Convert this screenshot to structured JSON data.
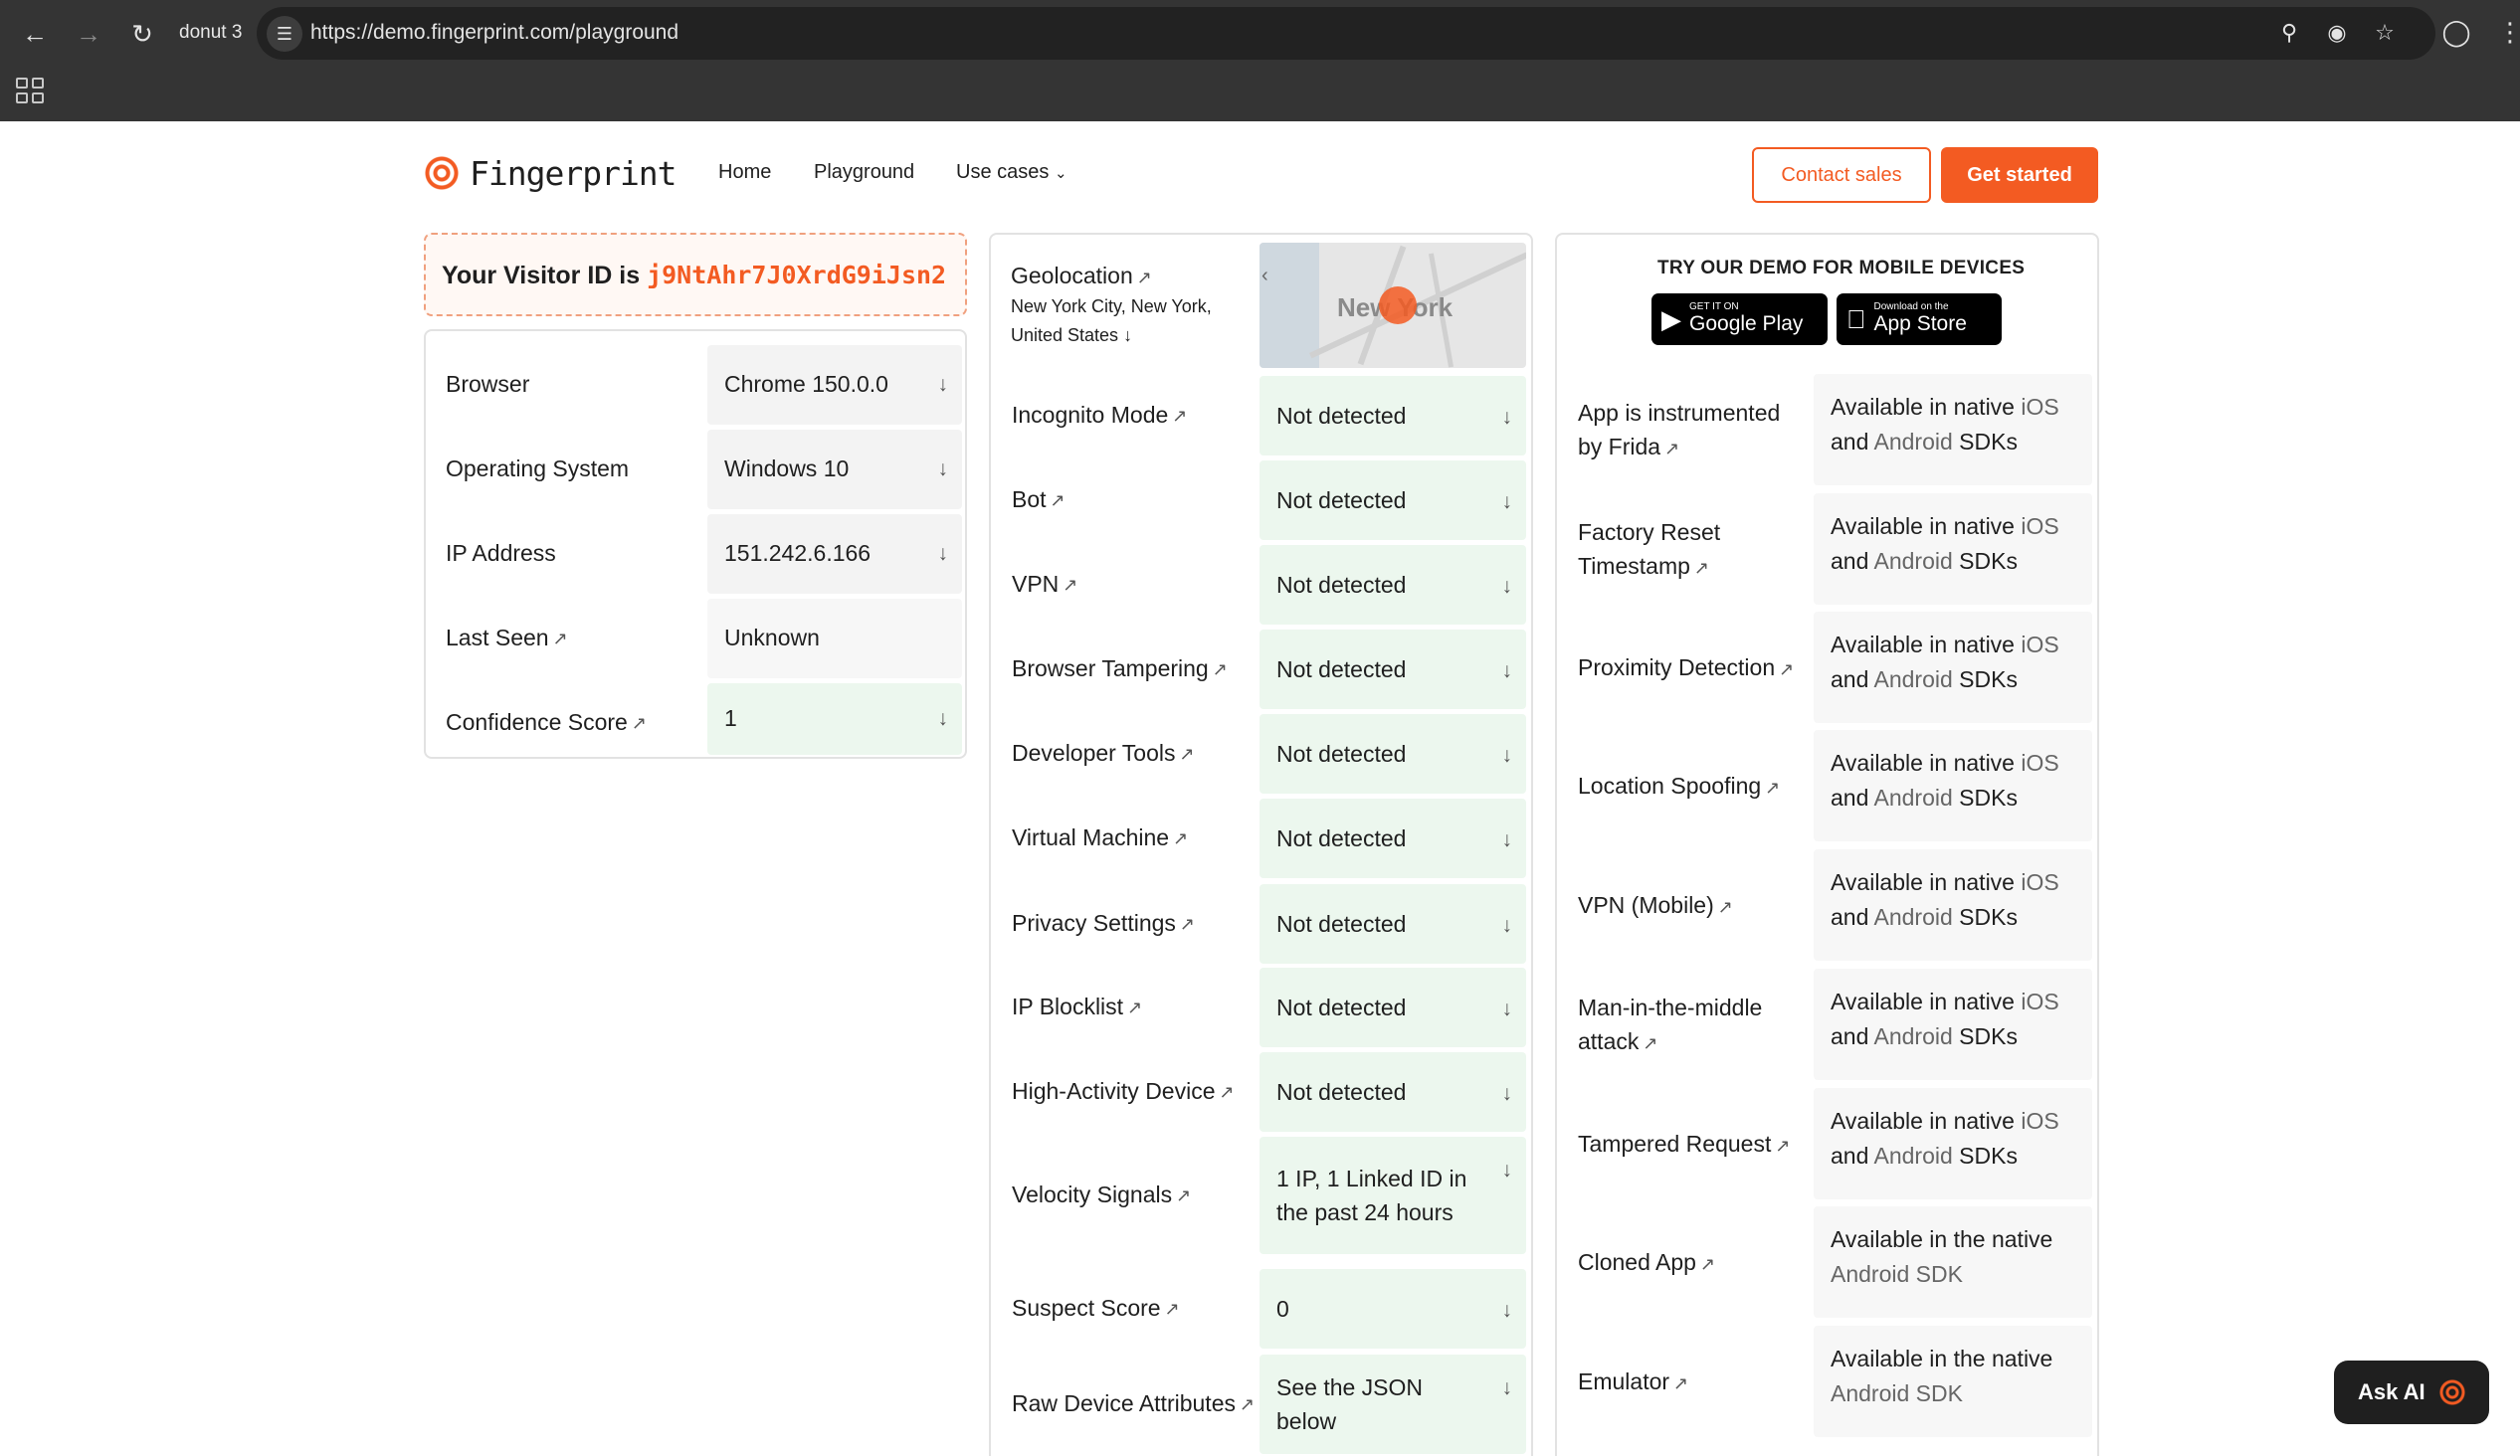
{
  "browser": {
    "tab_title": "donut 3",
    "url": "https://demo.fingerprint.com/playground"
  },
  "header": {
    "brand": "Fingerprint",
    "nav": [
      "Home",
      "Playground",
      "Use cases"
    ],
    "contact_sales": "Contact sales",
    "get_started": "Get started"
  },
  "visitor": {
    "prefix": "Your Visitor ID is",
    "id": "j9NtAhr7J0XrdG9iJsn2"
  },
  "identification": [
    {
      "label": "Browser",
      "value": "Chrome 150.0.0"
    },
    {
      "label": "Operating System",
      "value": "Windows 10"
    },
    {
      "label": "IP Address",
      "value": "151.242.6.166"
    },
    {
      "label": "Last Seen",
      "value": "Unknown"
    },
    {
      "label": "Confidence Score",
      "value": "1"
    }
  ],
  "geolocation": {
    "label": "Geolocation",
    "location": "New York City, New York, United States",
    "map_label": "New York"
  },
  "smart_signals": [
    {
      "label": "Incognito Mode",
      "value": "Not detected"
    },
    {
      "label": "Bot",
      "value": "Not detected"
    },
    {
      "label": "VPN",
      "value": "Not detected"
    },
    {
      "label": "Browser Tampering",
      "value": "Not detected"
    },
    {
      "label": "Developer Tools",
      "value": "Not detected"
    },
    {
      "label": "Virtual Machine",
      "value": "Not detected"
    },
    {
      "label": "Privacy Settings",
      "value": "Not detected"
    },
    {
      "label": "IP Blocklist",
      "value": "Not detected"
    },
    {
      "label": "High-Activity Device",
      "value": "Not detected"
    },
    {
      "label": "Velocity Signals",
      "value": "1 IP, 1 Linked ID in the past 24 hours"
    },
    {
      "label": "Suspect Score",
      "value": "0"
    },
    {
      "label": "Raw Device Attributes",
      "value": "See the JSON below"
    }
  ],
  "mobile": {
    "title": "TRY OUR DEMO FOR MOBILE DEVICES",
    "google_play_small": "GET IT ON",
    "google_play_big": "Google Play",
    "app_store_small": "Download on the",
    "app_store_big": "App Store",
    "signals": [
      {
        "label": "App is instrumented by Frida",
        "available": "Available in native",
        "ios": "iOS",
        "and": "and",
        "android": "Android",
        "sdks": "SDKs"
      },
      {
        "label": "Factory Reset Timestamp",
        "available": "Available in native",
        "ios": "iOS",
        "and": "and",
        "android": "Android",
        "sdks": "SDKs"
      },
      {
        "label": "Proximity Detection",
        "available": "Available in native",
        "ios": "iOS",
        "and": "and",
        "android": "Android",
        "sdks": "SDKs"
      },
      {
        "label": "Location Spoofing",
        "available": "Available in native",
        "ios": "iOS",
        "and": "and",
        "android": "Android",
        "sdks": "SDKs"
      },
      {
        "label": "VPN (Mobile)",
        "available": "Available in native",
        "ios": "iOS",
        "and": "and",
        "android": "Android",
        "sdks": "SDKs"
      },
      {
        "label": "Man-in-the-middle attack",
        "available": "Available in native",
        "ios": "iOS",
        "and": "and",
        "android": "Android",
        "sdks": "SDKs"
      },
      {
        "label": "Tampered Request",
        "available": "Available in native",
        "ios": "iOS",
        "and": "and",
        "android": "Android",
        "sdks": "SDKs"
      },
      {
        "label": "Cloned App",
        "available": "Available in the native",
        "android_sdk": "Android SDK"
      },
      {
        "label": "Emulator",
        "available": "Available in the native",
        "android_sdk": "Android SDK"
      }
    ]
  },
  "ask_ai": "Ask AI",
  "colors": {
    "brand": "#f35b22",
    "green_cell": "#ecf7ee",
    "grey_cell": "#f3f3f3"
  }
}
